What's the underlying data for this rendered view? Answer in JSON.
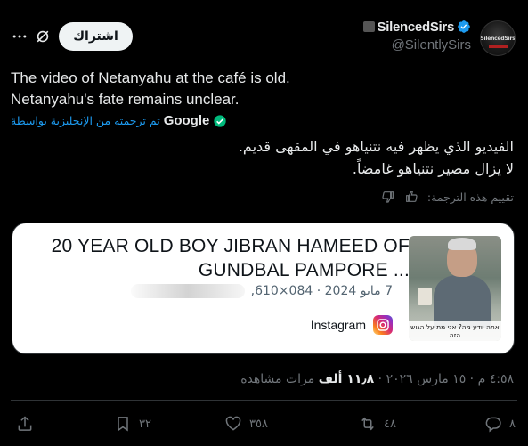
{
  "author": {
    "display_name": "SilencedSirs",
    "handle": "@SilentlySirs",
    "avatar_label": "SilencedSirs"
  },
  "header": {
    "subscribe_label": "اشتراك"
  },
  "tweet": {
    "text_line1": "The video of Netanyahu at the café is old.",
    "text_line2": "Netanyahu's fate remains unclear.",
    "translated_by_label": "تم ترجمته من الإنجليزية بواسطة",
    "translator": "Google",
    "translation_line1": "الفيديو الذي يظهر فيه نتنياهو في المقهى قديم.",
    "translation_line2": "لا يزال مصير نتنياهو غامضاً.",
    "rate_label": "تقييم هذه الترجمة:"
  },
  "card": {
    "title": "20 YEAR OLD BOY JIBRAN HAMEED OF GUNDBAL PAMPORE ...",
    "date": "7 مايو 2024",
    "size": "084×610,",
    "source": "Instagram",
    "thumb_caption": "אתה יודע מה? אני מת על הגוש הזה"
  },
  "meta": {
    "time": "٤:٥٨ م",
    "date": "١٥ مارس ٢٠٢٦",
    "views_count": "١١٫٨ ألف",
    "views_label": "مرات مشاهدة"
  },
  "actions": {
    "replies": "٨",
    "reposts": "٤٨",
    "likes": "٣٥٨",
    "bookmarks": "٣٢"
  },
  "colors": {
    "accent": "#1d9bf0",
    "verified": "#1d9bf0",
    "google_check": "#00ba7c",
    "background": "#000000",
    "muted": "#71767b"
  },
  "icons": [
    "verified-badge-icon",
    "grok-icon",
    "more-icon",
    "google-check-icon",
    "thumbs-up-icon",
    "thumbs-down-icon",
    "instagram-icon",
    "reply-icon",
    "repost-icon",
    "like-icon",
    "bookmark-icon",
    "share-icon"
  ]
}
